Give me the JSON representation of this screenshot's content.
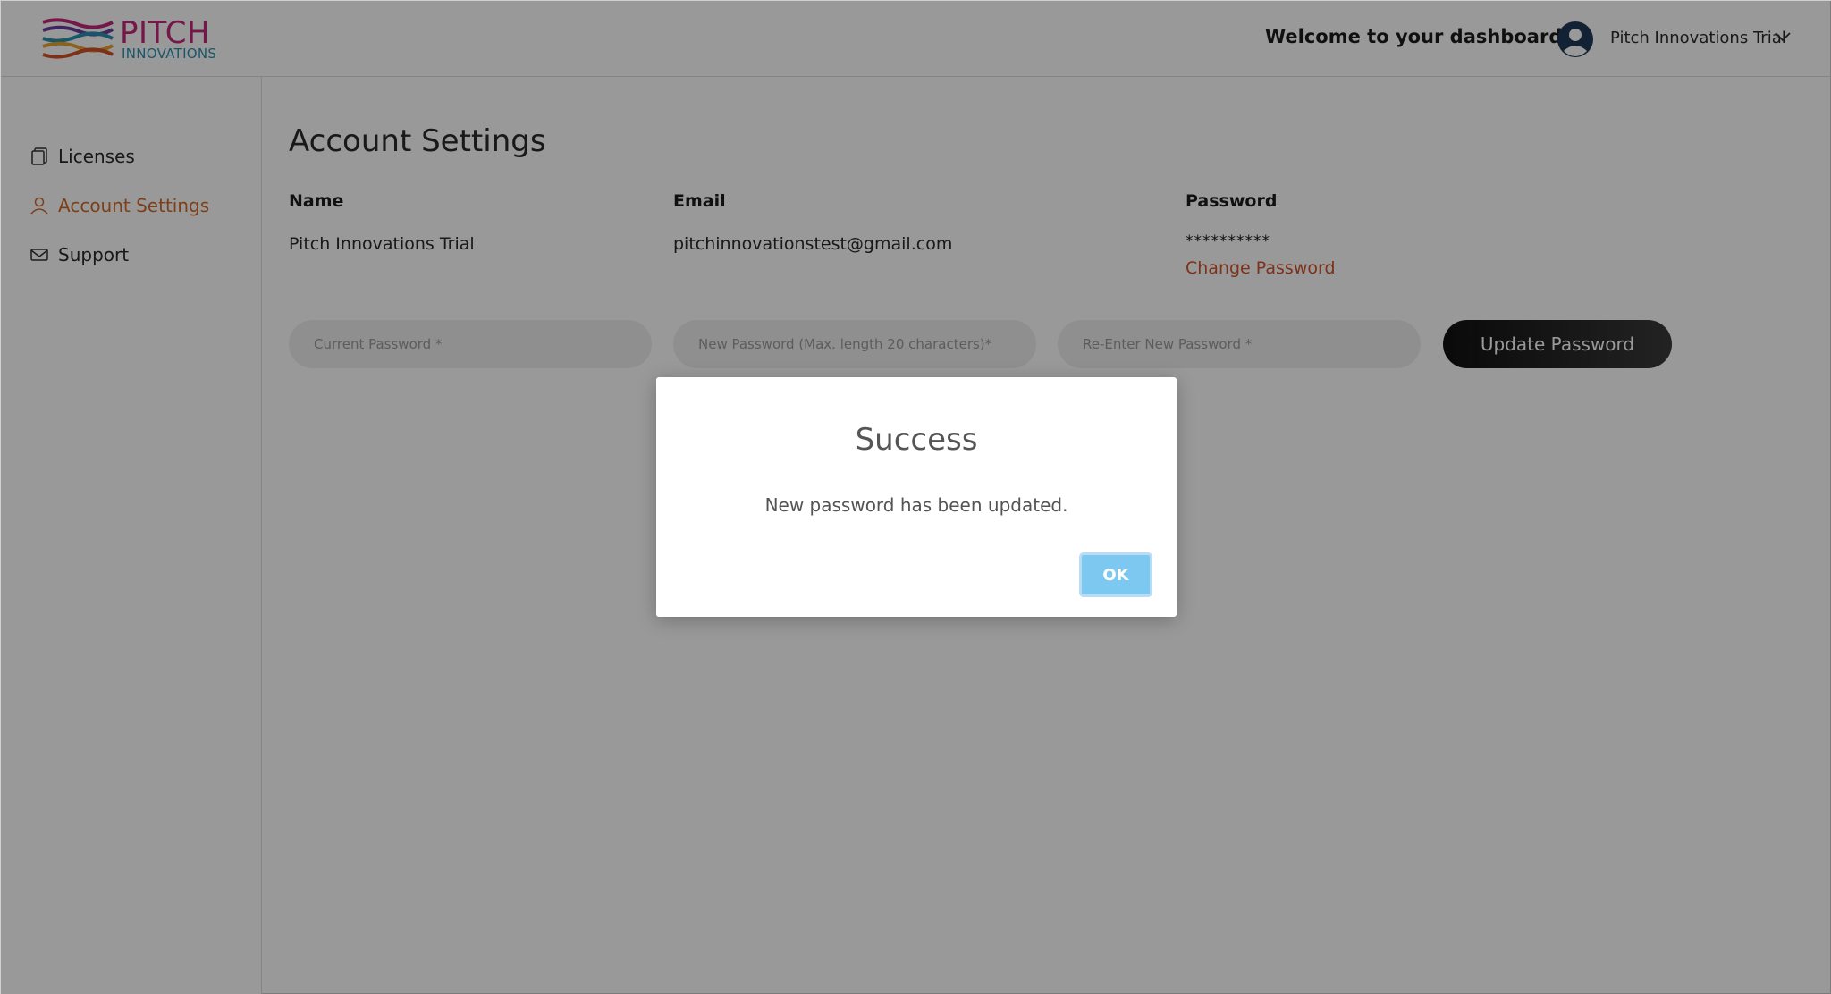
{
  "brand": {
    "name": "PITCH",
    "subtitle": "INNOVATIONS",
    "colors": {
      "primary": "#c2297a",
      "secondary": "#2a8fb0"
    }
  },
  "header": {
    "welcome": "Welcome to your dashboard!",
    "user_name": "Pitch Innovations Trial",
    "avatar_icon": "user-circle-icon",
    "menu_icon": "chevron-down-icon"
  },
  "sidebar": {
    "items": [
      {
        "label": "Licenses",
        "icon": "document-icon",
        "active": false
      },
      {
        "label": "Account Settings",
        "icon": "user-icon",
        "active": true
      },
      {
        "label": "Support",
        "icon": "envelope-icon",
        "active": false
      }
    ],
    "active_color": "#d06a2a"
  },
  "main": {
    "title": "Account Settings",
    "columns": {
      "name_label": "Name",
      "name_value": "Pitch Innovations Trial",
      "email_label": "Email",
      "email_value": "pitchinnovationstest@gmail.com",
      "password_label": "Password",
      "password_mask": "**********",
      "change_password": "Change Password"
    },
    "form": {
      "current_placeholder": "Current Password *",
      "new_placeholder": "New Password (Max. length 20 characters)*",
      "reenter_placeholder": "Re-Enter New Password *",
      "update_label": "Update Password"
    }
  },
  "modal": {
    "title": "Success",
    "message": "New password has been updated.",
    "ok_label": "OK",
    "ok_color": "#7cc8f1"
  }
}
